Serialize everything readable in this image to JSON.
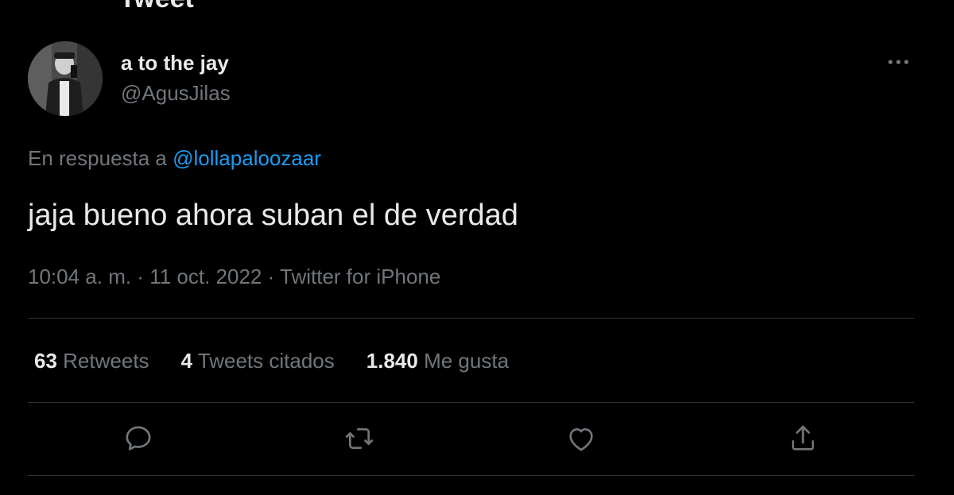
{
  "header": {
    "title": "Tweet"
  },
  "author": {
    "display_name": "a to the jay",
    "handle": "@AgusJilas"
  },
  "reply": {
    "prefix": "En respuesta a ",
    "mention": "@lollapaloozaar"
  },
  "tweet": {
    "text": "jaja bueno ahora suban el de verdad",
    "time": "10:04 a. m.",
    "separator": " · ",
    "date": "11 oct. 2022",
    "source": "Twitter for iPhone"
  },
  "stats": {
    "retweets": {
      "value": "63",
      "label": "Retweets"
    },
    "quotes": {
      "value": "4",
      "label": "Tweets citados"
    },
    "likes": {
      "value": "1.840",
      "label": "Me gusta"
    }
  },
  "icons": {
    "back": "arrow-left-icon",
    "more": "more-horizontal-icon",
    "reply": "reply-icon",
    "retweet": "retweet-icon",
    "like": "heart-icon",
    "share": "share-icon"
  },
  "colors": {
    "background": "#000000",
    "text": "#e7e9ea",
    "muted": "#71767b",
    "accent": "#1d9bf0",
    "divider": "#2f3336"
  }
}
